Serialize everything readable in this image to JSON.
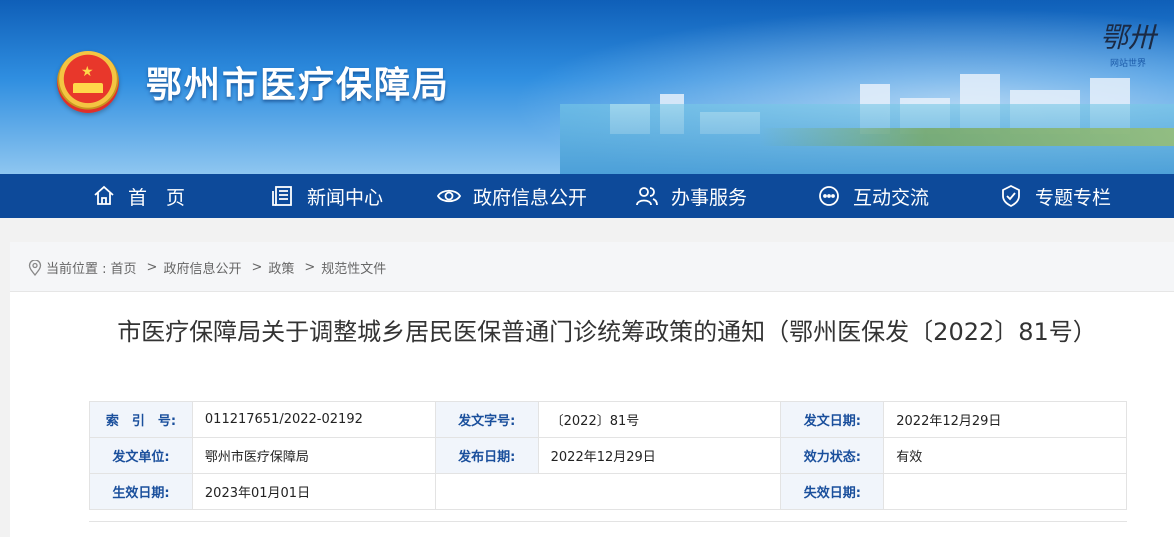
{
  "header": {
    "site_title": "鄂州市医疗保障局",
    "logo_text": "鄂卅",
    "logo_sub": "网站世界"
  },
  "nav": [
    {
      "label": "首　页",
      "icon": "home-icon"
    },
    {
      "label": "新闻中心",
      "icon": "newspaper-icon"
    },
    {
      "label": "政府信息公开",
      "icon": "eye-icon"
    },
    {
      "label": "办事服务",
      "icon": "people-icon"
    },
    {
      "label": "互动交流",
      "icon": "chat-icon"
    },
    {
      "label": "专题专栏",
      "icon": "shield-icon"
    }
  ],
  "breadcrumb": {
    "prefix": "当前位置 :",
    "items": [
      "首页",
      "政府信息公开",
      "政策",
      "规范性文件"
    ],
    "separator": ">"
  },
  "document": {
    "title": "市医疗保障局关于调整城乡居民医保普通门诊统筹政策的通知（鄂州医保发〔2022〕81号）"
  },
  "meta_table": {
    "rows": [
      [
        {
          "k": "索　引　号:",
          "v": "011217651/2022-02192"
        },
        {
          "k": "发文字号:",
          "v": "〔2022〕81号"
        },
        {
          "k": "发文日期:",
          "v": "2022年12月29日"
        }
      ],
      [
        {
          "k": "发文单位:",
          "v": "鄂州市医疗保障局"
        },
        {
          "k": "发布日期:",
          "v": "2022年12月29日"
        },
        {
          "k": "效力状态:",
          "v": "有效"
        }
      ],
      [
        {
          "k": "生效日期:",
          "v": "2023年01月01日"
        },
        {
          "k": "",
          "v": ""
        },
        {
          "k": "失效日期:",
          "v": ""
        }
      ]
    ]
  },
  "colors": {
    "nav_bg": "#0d4a9a",
    "label_blue": "#1a4f9c",
    "label_bg": "#f1f5fb"
  }
}
